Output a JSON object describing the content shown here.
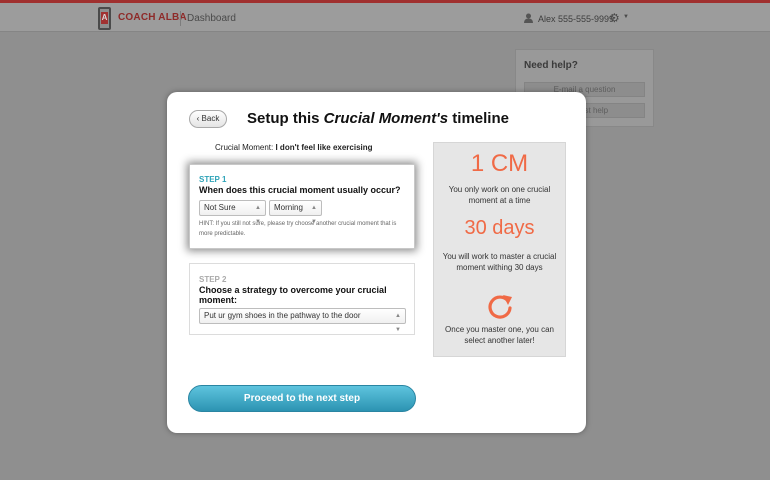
{
  "topbar": {
    "brand": "COACH ALBA",
    "dashboard_link": "Dashboard",
    "user_label": "Alex 555-555-9999",
    "icons": [
      "phone-logo-icon",
      "user-icon",
      "gear-icon",
      "caret-down-icon"
    ]
  },
  "help": {
    "title": "Need help?",
    "email_button": "E-mail a question",
    "request_button": "Request help"
  },
  "modal": {
    "back_label": "Back",
    "title_prefix": "Setup this ",
    "title_emphasis": "Crucial Moment's",
    "title_suffix": " timeline",
    "crucial_moment_label": "Crucial Moment:",
    "crucial_moment_value": "I don't feel like exercising",
    "step1": {
      "label": "STEP 1",
      "question": "When does this crucial moment usually occur?",
      "when_value": "Not Sure",
      "part_of_day_value": "Morning",
      "hint": "HINT: If you still not sure, please try choose another crucial moment that is more predictable."
    },
    "step2": {
      "label": "STEP 2",
      "question": "Choose a strategy to overcome your crucial moment:",
      "strategy_value": "Put ur gym shoes in the pathway to the door"
    },
    "proceed_label": "Proceed to the next step",
    "info": {
      "cm_count": "1 CM",
      "cm_text": "You only work on one crucial moment at a time",
      "days": "30 days",
      "days_text": "You will work to master a crucial moment withing 30 days",
      "after_text": "Once you master one, you can select another later!",
      "icon": "refresh-icon"
    }
  },
  "colors": {
    "accent_orange": "#f06a46",
    "step_teal": "#2ea3b8",
    "button_blue": "#3aa6c6",
    "brand_red": "#a13131"
  }
}
